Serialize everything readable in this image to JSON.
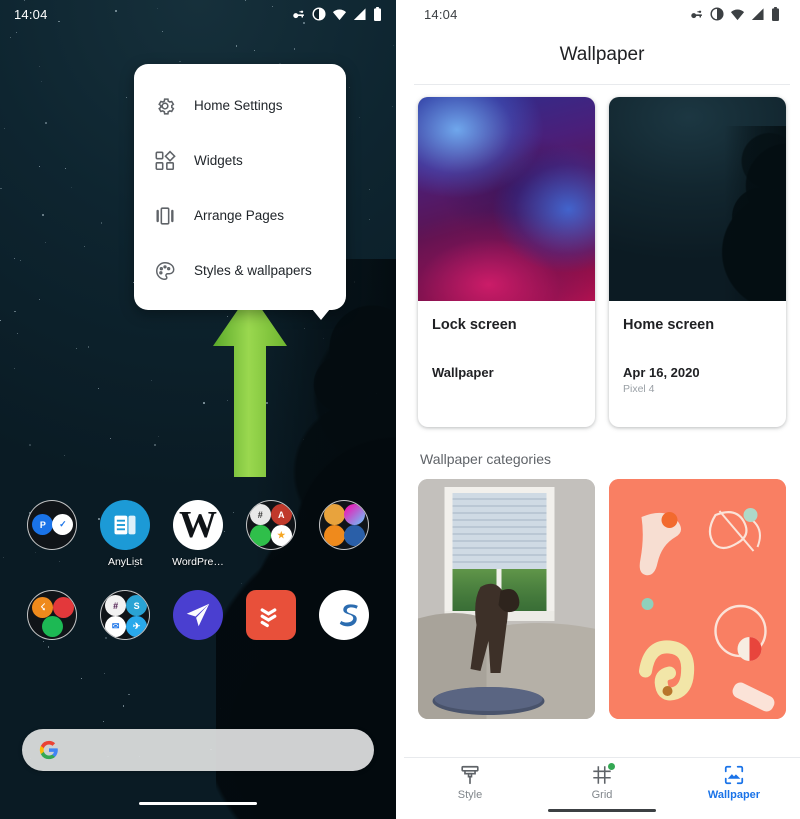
{
  "left_phone": {
    "status_bar": {
      "time": "14:04",
      "icons": [
        "vpn-key-icon",
        "do-not-disturb-icon",
        "wifi-icon",
        "cellular-signal-icon",
        "battery-icon"
      ]
    },
    "popup_menu": {
      "items": [
        {
          "label": "Home Settings",
          "icon": "gear-icon"
        },
        {
          "label": "Widgets",
          "icon": "widgets-icon"
        },
        {
          "label": "Arrange Pages",
          "icon": "arrange-pages-icon"
        },
        {
          "label": "Styles & wallpapers",
          "icon": "palette-icon"
        }
      ]
    },
    "annotation": {
      "arrow": "green-up-arrow",
      "color": "#86c232"
    },
    "app_rows": [
      [
        {
          "label": "",
          "type": "folder",
          "name": "folder-blue-apps"
        },
        {
          "label": "AnyList",
          "type": "app",
          "name": "anylist-app"
        },
        {
          "label": "WordPre…",
          "type": "app",
          "name": "wordpress-app"
        },
        {
          "label": "",
          "type": "folder",
          "name": "folder-misc-apps"
        },
        {
          "label": "",
          "type": "folder",
          "name": "folder-orange-apps"
        }
      ],
      [
        {
          "label": "",
          "type": "folder",
          "name": "folder-media-apps"
        },
        {
          "label": "",
          "type": "folder",
          "name": "folder-chat-apps"
        },
        {
          "label": "",
          "type": "app",
          "name": "spark-mail-app"
        },
        {
          "label": "",
          "type": "app",
          "name": "todoist-app"
        },
        {
          "label": "",
          "type": "app",
          "name": "simplenote-app"
        }
      ]
    ],
    "search": {
      "icon": "google-g-icon",
      "placeholder": ""
    }
  },
  "right_phone": {
    "status_bar": {
      "time": "14:04",
      "icons": [
        "vpn-key-icon",
        "do-not-disturb-icon",
        "wifi-icon",
        "cellular-signal-icon",
        "battery-icon"
      ]
    },
    "title": "Wallpaper",
    "previews": [
      {
        "title": "Lock screen",
        "sub": "Wallpaper",
        "sub2": "",
        "thumb": "nebula-purple-wallpaper"
      },
      {
        "title": "Home screen",
        "sub": "Apr 16, 2020",
        "sub2": "Pixel 4",
        "thumb": "night-sky-tree-wallpaper"
      }
    ],
    "section_title": "Wallpaper categories",
    "categories": [
      {
        "name": "my-photos-category",
        "thumb": "dog-at-window-photo"
      },
      {
        "name": "living-universe-category",
        "thumb": "coral-abstract-shapes"
      }
    ],
    "bottom_nav": {
      "items": [
        {
          "label": "Style",
          "icon": "paint-brush-icon",
          "active": false,
          "badge": false
        },
        {
          "label": "Grid",
          "icon": "grid-icon",
          "active": false,
          "badge": true
        },
        {
          "label": "Wallpaper",
          "icon": "wallpaper-frame-icon",
          "active": true,
          "badge": false
        }
      ],
      "active_color": "#1a73e8",
      "badge_color": "#34a853"
    }
  }
}
